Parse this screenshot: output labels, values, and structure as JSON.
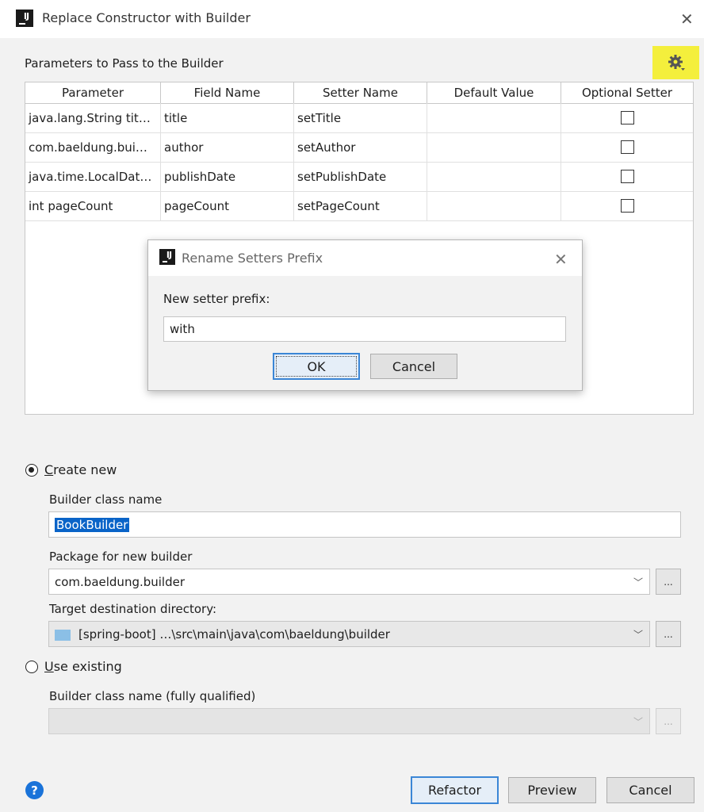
{
  "window": {
    "title": "Replace Constructor with Builder",
    "close_icon": "✕"
  },
  "parameters": {
    "section_label": "Parameters to Pass to the Builder",
    "settings_icon": "gear-icon",
    "columns": [
      "Parameter",
      "Field Name",
      "Setter Name",
      "Default Value",
      "Optional Setter"
    ],
    "rows": [
      {
        "parameter": "java.lang.String tit…",
        "field": "title",
        "setter": "setTitle",
        "default": "",
        "optional": false
      },
      {
        "parameter": "com.baeldung.bui…",
        "field": "author",
        "setter": "setAuthor",
        "default": "",
        "optional": false
      },
      {
        "parameter": "java.time.LocalDat…",
        "field": "publishDate",
        "setter": "setPublishDate",
        "default": "",
        "optional": false
      },
      {
        "parameter": "int pageCount",
        "field": "pageCount",
        "setter": "setPageCount",
        "default": "",
        "optional": false
      }
    ]
  },
  "rename_dialog": {
    "title": "Rename Setters Prefix",
    "close_icon": "✕",
    "label": "New setter prefix:",
    "value": "with",
    "ok_label": "OK",
    "cancel_label": "Cancel"
  },
  "builder": {
    "create_new": {
      "accel": "C",
      "rest": "reate new",
      "checked": true
    },
    "class_name_label": "Builder class name",
    "class_name_value": "BookBuilder",
    "package_label": "Package for new builder",
    "package_value": "com.baeldung.builder",
    "target_label": "Target destination directory:",
    "target_value": "[spring-boot] …\\src\\main\\java\\com\\baeldung\\builder",
    "use_existing": {
      "accel": "U",
      "rest": "se existing",
      "checked": false
    },
    "fq_label": "Builder class name (fully qualified)",
    "fq_value": "",
    "browse_label": "...",
    "chevron": "﹀"
  },
  "footer": {
    "help_label": "?",
    "refactor_label": "Refactor",
    "preview_label": "Preview",
    "cancel_label": "Cancel"
  },
  "colors": {
    "highlight": "#f4ef3c",
    "accent": "#3b86d6",
    "selection": "#0a64c8",
    "help": "#1a73d9"
  }
}
